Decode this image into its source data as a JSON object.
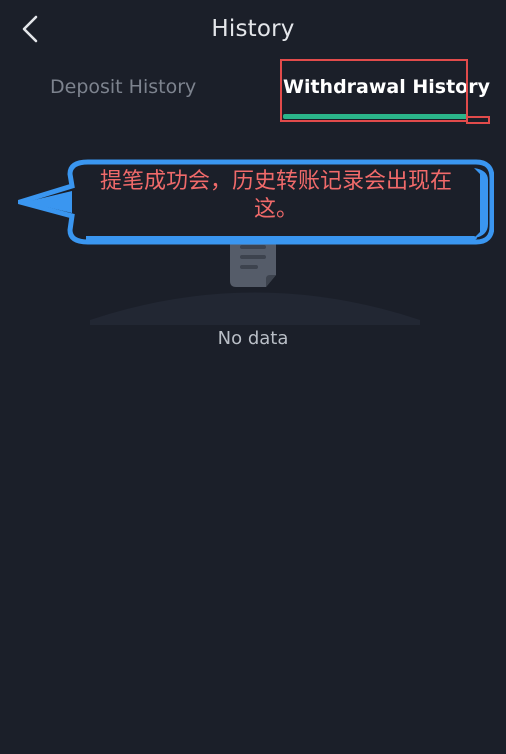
{
  "header": {
    "title": "History",
    "back_icon": "chevron-left-icon"
  },
  "tabs": [
    {
      "label": "Deposit History",
      "active": false
    },
    {
      "label": "Withdrawal History",
      "active": true
    }
  ],
  "colors": {
    "background": "#1b1f29",
    "active_underline": "#2bb58a",
    "highlight_border": "#e24b4b",
    "callout_fill": "#3a96f0",
    "callout_text": "#f06a6a"
  },
  "empty_state": {
    "icon": "document-icon",
    "label": "No data"
  },
  "annotation": {
    "text": "提笔成功会，历史转账记录会出现在这。"
  }
}
